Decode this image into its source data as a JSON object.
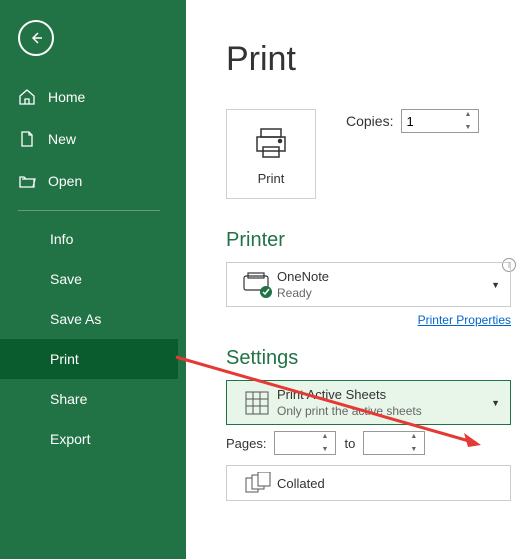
{
  "sidebar": {
    "home": "Home",
    "new": "New",
    "open": "Open",
    "info": "Info",
    "save": "Save",
    "saveAs": "Save As",
    "print": "Print",
    "share": "Share",
    "export": "Export"
  },
  "main": {
    "title": "Print",
    "printButton": "Print",
    "copies": {
      "label": "Copies:",
      "value": "1"
    },
    "printer": {
      "heading": "Printer",
      "name": "OneNote",
      "status": "Ready",
      "propertiesLink": "Printer Properties"
    },
    "settings": {
      "heading": "Settings",
      "sheets": {
        "primary": "Print Active Sheets",
        "secondary": "Only print the active sheets"
      },
      "pages": {
        "label": "Pages:",
        "to": "to"
      },
      "collated": "Collated"
    }
  }
}
